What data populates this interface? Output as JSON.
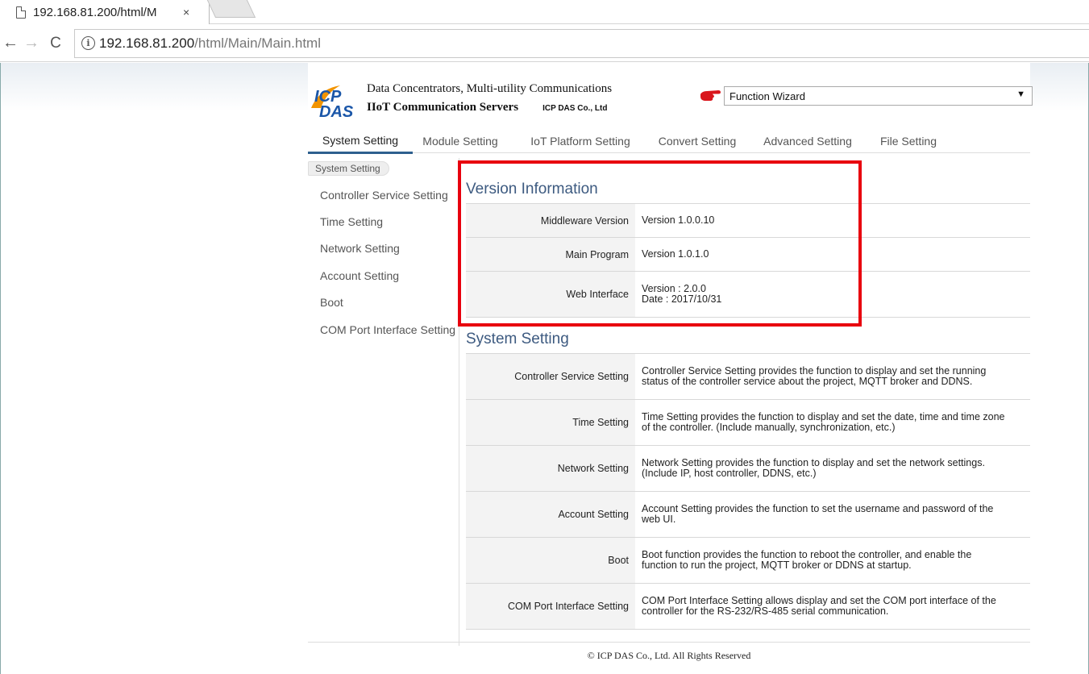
{
  "browser": {
    "tab_title": "192.168.81.200/html/M",
    "tab_close": "×",
    "url_host": "192.168.81.200",
    "url_path": "/html/Main/Main.html",
    "info_glyph": "i"
  },
  "header": {
    "logo_text_top": "ICP",
    "logo_text_bottom": "DAS",
    "line1": "Data Concentrators, Multi-utility Communications",
    "line2": "IIoT Communication Servers",
    "company": "ICP DAS Co., Ltd",
    "wizard_selected": "Function Wizard",
    "wizard_arrow": "▼"
  },
  "mainnav": [
    {
      "label": "System Setting",
      "active": true
    },
    {
      "label": "Module Setting"
    },
    {
      "label": "IoT Platform Setting"
    },
    {
      "label": "Convert Setting"
    },
    {
      "label": "Advanced Setting"
    },
    {
      "label": "File Setting"
    }
  ],
  "sidebar": {
    "breadcrumb": "System Setting",
    "items": [
      "Controller Service Setting",
      "Time Setting",
      "Network Setting",
      "Account Setting",
      "Boot",
      "COM Port Interface Setting"
    ]
  },
  "version_info": {
    "title": "Version Information",
    "rows": [
      {
        "label": "Middleware Version",
        "value": "Version 1.0.0.10"
      },
      {
        "label": "Main Program",
        "value": "Version 1.0.1.0"
      },
      {
        "label": "Web Interface",
        "value": "Version : 2.0.0",
        "value2": "Date : 2017/10/31"
      }
    ]
  },
  "system_setting": {
    "title": "System Setting",
    "rows": [
      {
        "label": "Controller Service Setting",
        "value": "Controller Service Setting provides the function to display and set the running",
        "value2": "status of the controller service about the project, MQTT broker and DDNS."
      },
      {
        "label": "Time Setting",
        "value": "Time Setting provides the function to display and set the date, time and time zone",
        "value2": "of the controller. (Include manually, synchronization, etc.)"
      },
      {
        "label": "Network Setting",
        "value": "Network Setting provides the function to display and set the network settings.",
        "value2": "(Include IP, host controller, DDNS, etc.)"
      },
      {
        "label": "Account Setting",
        "value": "Account Setting provides the function to set the username and password of the",
        "value2": "web UI."
      },
      {
        "label": "Boot",
        "value": "Boot function provides the function to reboot the controller, and enable the",
        "value2": "function to run the project, MQTT broker or DDNS at startup."
      },
      {
        "label": "COM Port Interface Setting",
        "value": "COM Port Interface Setting allows display and set the COM port interface of the",
        "value2": "controller for the RS-232/RS-485 serial communication."
      }
    ]
  },
  "footer": "© ICP DAS Co., Ltd. All Rights Reserved",
  "colors": {
    "accent": "#2d5f8e",
    "highlight": "#e8000e",
    "logo_orange": "#f29400",
    "logo_blue": "#1a56a8"
  }
}
